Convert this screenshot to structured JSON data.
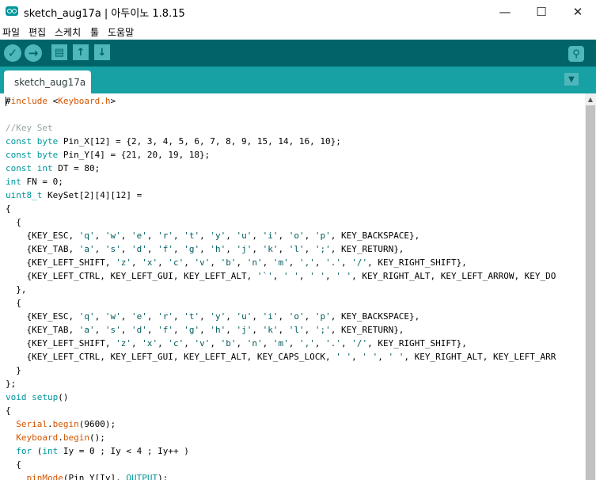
{
  "window": {
    "title": "sketch_aug17a | 아두이노 1.8.15",
    "minimize_glyph": "—",
    "maximize_glyph": "☐",
    "close_glyph": "✕"
  },
  "menu": [
    "파일",
    "편집",
    "스케치",
    "툴",
    "도움말"
  ],
  "toolbar": {
    "verify_glyph": "✓",
    "upload_glyph": "→",
    "new_glyph": "▤",
    "open_glyph": "↑",
    "save_glyph": "↓",
    "serial_glyph": "⚲"
  },
  "tabs": [
    {
      "label": "sketch_aug17a"
    }
  ],
  "tab_menu_glyph": "▼",
  "scroll_up_glyph": "▲",
  "editor": {
    "lines": [
      "#include <Keyboard.h>",
      "",
      "//Key Set",
      "const byte Pin_X[12] = {2, 3, 4, 5, 6, 7, 8, 9, 15, 14, 16, 10};",
      "const byte Pin_Y[4] = {21, 20, 19, 18};",
      "const int DT = 80;",
      "int FN = 0;",
      "uint8_t KeySet[2][4][12] =",
      "{",
      "  {",
      "    {KEY_ESC, 'q', 'w', 'e', 'r', 't', 'y', 'u', 'i', 'o', 'p', KEY_BACKSPACE},",
      "    {KEY_TAB, 'a', 's', 'd', 'f', 'g', 'h', 'j', 'k', 'l', ';', KEY_RETURN},",
      "    {KEY_LEFT_SHIFT, 'z', 'x', 'c', 'v', 'b', 'n', 'm', ',', '.', '/', KEY_RIGHT_SHIFT},",
      "    {KEY_LEFT_CTRL, KEY_LEFT_GUI, KEY_LEFT_ALT, '`', ' ', ' ', ' ', KEY_RIGHT_ALT, KEY_LEFT_ARROW, KEY_DO",
      "  },",
      "  {",
      "    {KEY_ESC, 'q', 'w', 'e', 'r', 't', 'y', 'u', 'i', 'o', 'p', KEY_BACKSPACE},",
      "    {KEY_TAB, 'a', 's', 'd', 'f', 'g', 'h', 'j', 'k', 'l', ';', KEY_RETURN},",
      "    {KEY_LEFT_SHIFT, 'z', 'x', 'c', 'v', 'b', 'n', 'm', ',', '.', '/', KEY_RIGHT_SHIFT},",
      "    {KEY_LEFT_CTRL, KEY_LEFT_GUI, KEY_LEFT_ALT, KEY_CAPS_LOCK, ' ', ' ', ' ', KEY_RIGHT_ALT, KEY_LEFT_ARR",
      "  }",
      "};",
      "void setup()",
      "{",
      "  Serial.begin(9600);",
      "  Keyboard.begin();",
      "  for (int Iy = 0 ; Iy < 4 ; Iy++ )",
      "  {",
      "    pinMode(Pin_Y[Iy], OUTPUT);"
    ]
  },
  "colors": {
    "toolbar_bg": "#006468",
    "tabstrip_bg": "#17a1a5",
    "button_bg": "#4db7bb",
    "keyword": "#00979c",
    "library": "#d35400",
    "string": "#005c5f",
    "comment": "#95a5a6"
  }
}
